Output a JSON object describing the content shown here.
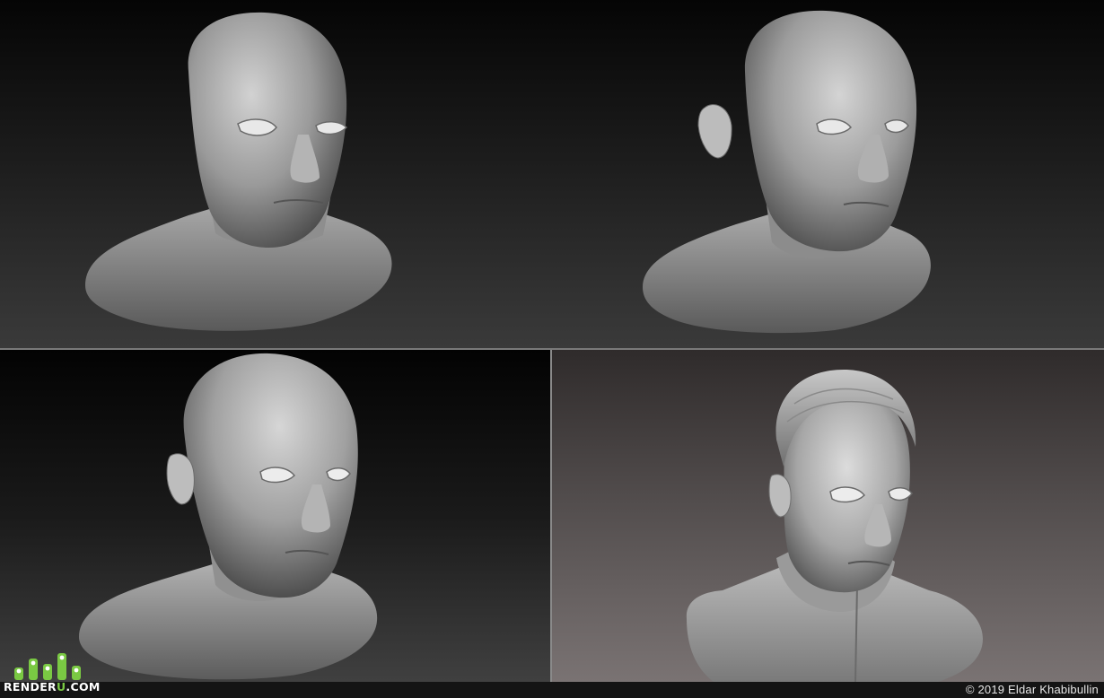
{
  "logo": {
    "text_main": "RENDER",
    "text_accent": "U",
    "text_tail": ".COM",
    "accent_color": "#7ac943"
  },
  "credit": "© 2019 Eldar Khabibullin",
  "panels": [
    {
      "stage": "base-head"
    },
    {
      "stage": "head-with-ear"
    },
    {
      "stage": "refined-bust"
    },
    {
      "stage": "bust-with-hair-and-collar"
    }
  ]
}
